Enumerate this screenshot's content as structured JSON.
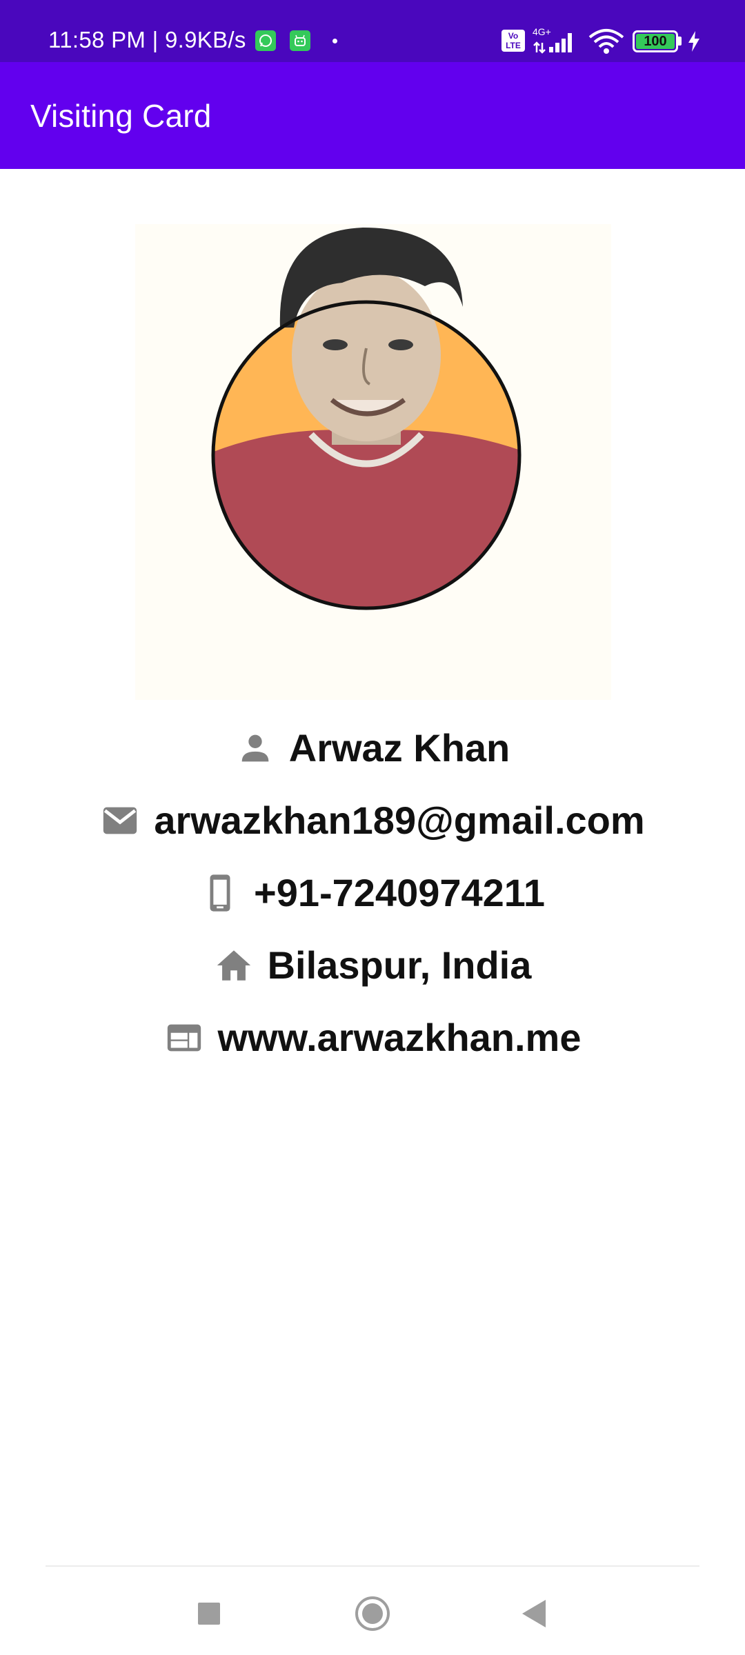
{
  "status_bar": {
    "time_speed": "11:58 PM | 9.9KB/s",
    "network_label": "4G+",
    "volte_label": "Vo LTE",
    "battery_level": "100"
  },
  "app_bar": {
    "title": "Visiting Card"
  },
  "profile": {
    "name": "Arwaz Khan",
    "email": "arwazkhan189@gmail.com",
    "phone": "+91-7240974211",
    "location": "Bilaspur, India",
    "website": "www.arwazkhan.me"
  },
  "icons": {
    "name": "person-icon",
    "email": "mail-icon",
    "phone": "phone-icon",
    "location": "home-icon",
    "website": "web-icon"
  },
  "colors": {
    "status_bar": "#4a07bd",
    "app_bar": "#6200ee",
    "icon_gray": "#808080",
    "photo_bg": "#ffb655",
    "shirt": "#b04a55"
  }
}
